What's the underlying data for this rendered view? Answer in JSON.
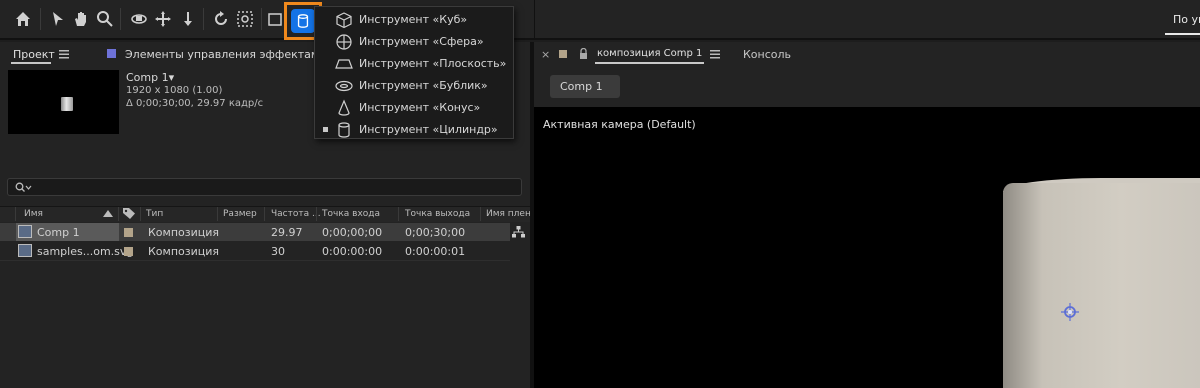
{
  "toolbar": {
    "tools": [
      "home-icon",
      "selection-icon",
      "hand-icon",
      "zoom-icon",
      "orbit-camera-icon",
      "pan-camera-icon",
      "dolly-camera-icon",
      "rotate-icon",
      "pan-behind-icon",
      "rectangle-icon",
      "cylinder-icon"
    ],
    "workspace_label": "По умолч"
  },
  "dropdown": {
    "items": [
      {
        "label": "Инструмент «Куб»",
        "icon": "cube-icon",
        "selected": false
      },
      {
        "label": "Инструмент «Сфера»",
        "icon": "sphere-icon",
        "selected": false
      },
      {
        "label": "Инструмент «Плоскость»",
        "icon": "plane-icon",
        "selected": false
      },
      {
        "label": "Инструмент «Бублик»",
        "icon": "torus-icon",
        "selected": false
      },
      {
        "label": "Инструмент «Конус»",
        "icon": "cone-icon",
        "selected": false
      },
      {
        "label": "Инструмент «Цилиндр»",
        "icon": "cylinder-icon",
        "selected": true
      }
    ]
  },
  "project": {
    "tab_label": "Проект",
    "effects_label": "Элементы управления эффектами svg",
    "comp_name": "Comp 1▾",
    "comp_size": "1920 x 1080 (1.00)",
    "comp_duration": "Δ 0;00;30;00, 29.97 кадр/с",
    "columns": {
      "name": "Имя",
      "type": "Тип",
      "size": "Размер",
      "fps": "Частота ...",
      "in": "Точка входа",
      "out": "Точка выхода",
      "file": "Имя плен"
    },
    "rows": [
      {
        "name": "Comp 1",
        "type": "Композиция",
        "size": "",
        "fps": "29.97",
        "in": "0;00;00;00",
        "out": "0;00;30;00"
      },
      {
        "name": "samples...om.svg",
        "type": "Композиция",
        "size": "",
        "fps": "30",
        "in": "0:00:00:00",
        "out": "0:00:00:01"
      }
    ]
  },
  "composition": {
    "close": "×",
    "tab_label": "композиция Comp 1",
    "console_label": "Консоль",
    "chip_label": "Comp 1",
    "camera_label": "Активная камера (Default)"
  },
  "colors": {
    "accent": "#1473e6",
    "highlight": "#f0891d",
    "label_color": "#b3a48a",
    "effects_swatch": "#6e72d8"
  }
}
